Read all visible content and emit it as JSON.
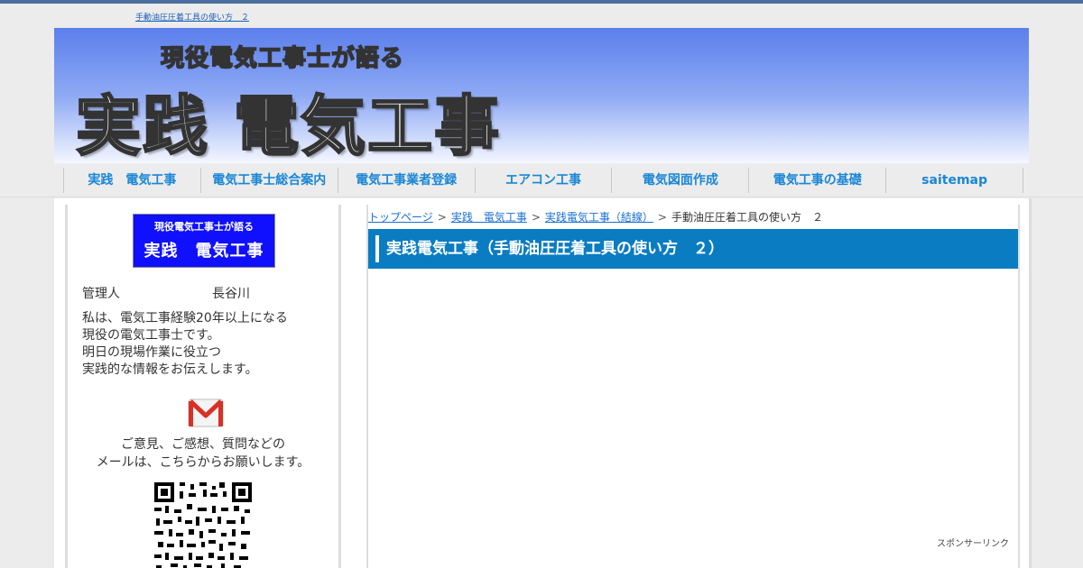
{
  "top_link": "手動油圧圧着工具の使い方　２",
  "header": {
    "subtitle": "現役電気工事士が語る",
    "title": "実践 電気工事"
  },
  "nav": {
    "items": [
      "実践　電気工事",
      "電気工事士総合案内",
      "電気工事業者登録",
      "エアコン工事",
      "電気図面作成",
      "電気工事の基礎",
      "saitemap"
    ]
  },
  "sidebar": {
    "logo_line1": "現役電気工事士が語る",
    "logo_line2": "実践　電気工事",
    "admin_label": "管理人",
    "admin_name": "長谷川",
    "intro": [
      "私は、電気工事経験20年以上になる",
      "現役の電気工事士です。",
      "明日の現場作業に役立つ",
      "実践的な情報をお伝えします。"
    ],
    "contact": [
      "ご意見、ご感想、質問などの",
      "メールは、こちらからお願いします。"
    ],
    "mail_icon": "gmail-icon",
    "qr_icon": "qr-code-icon"
  },
  "breadcrumb": {
    "items": [
      "トップページ",
      "実践　電気工事",
      "実践電気工事（結線）"
    ],
    "current": "手動油圧圧着工具の使い方　２",
    "separator": ">"
  },
  "article": {
    "title": "実践電気工事（手動油圧圧着工具の使い方　２）"
  },
  "sponsor_label": "スポンサーリンク",
  "colors": {
    "title_bar": "#0a7cc2",
    "nav_text": "#1a86d6",
    "link": "#1a6fd4"
  }
}
